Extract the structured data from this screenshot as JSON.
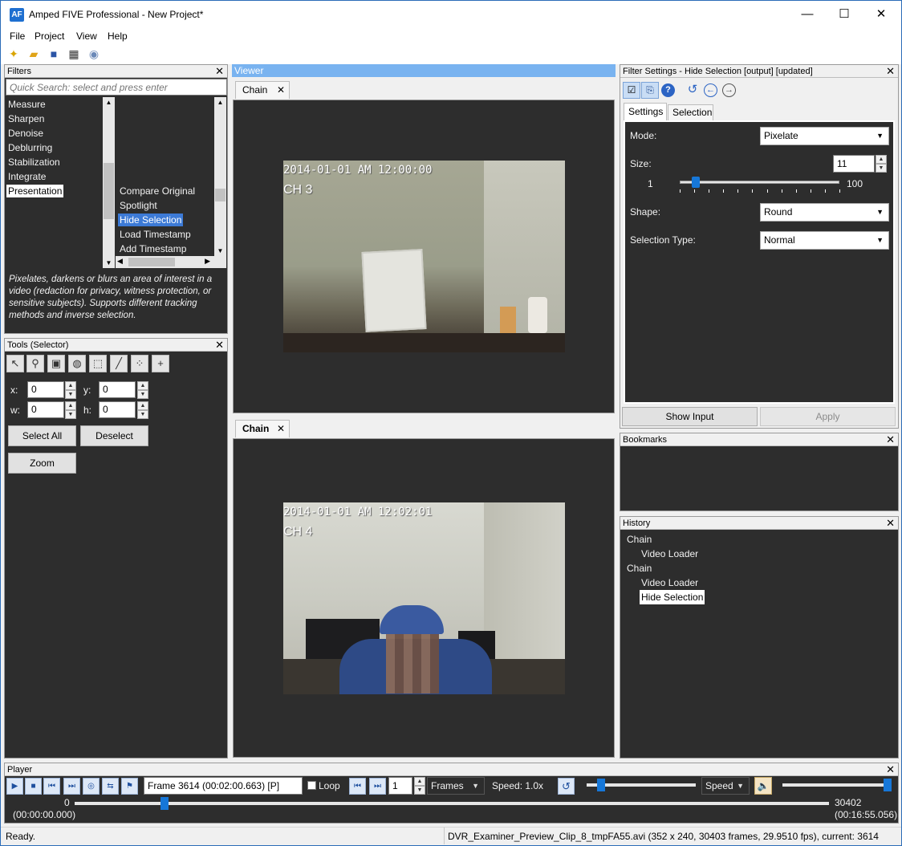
{
  "app": {
    "icon_text": "AF",
    "title": "Amped FIVE Professional - New Project*"
  },
  "window_controls": {
    "minimize": "—",
    "maximize": "☐",
    "close": "✕"
  },
  "menu": [
    "File",
    "Project",
    "View",
    "Help"
  ],
  "filters": {
    "title": "Filters",
    "search_placeholder": "Quick Search: select and press enter",
    "categories": [
      "Measure",
      "Sharpen",
      "Denoise",
      "Deblurring",
      "Stabilization",
      "Integrate",
      "Presentation"
    ],
    "selected_category": "Presentation",
    "items": [
      "Compare Original",
      "Spotlight",
      "Hide Selection",
      "Load Timestamp",
      "Add Timestamp"
    ],
    "selected_item": "Hide Selection",
    "description": "Pixelates, darkens or blurs an area of interest in a video (redaction for privacy, witness protection, or sensitive subjects). Supports different tracking methods and inverse selection."
  },
  "tools": {
    "title": "Tools (Selector)",
    "x_label": "x:",
    "x_value": "0",
    "y_label": "y:",
    "y_value": "0",
    "w_label": "w:",
    "w_value": "0",
    "h_label": "h:",
    "h_value": "0",
    "select_all": "Select All",
    "deselect": "Deselect",
    "zoom": "Zoom"
  },
  "viewer": {
    "title": "Viewer",
    "top_tab": "Chain",
    "bottom_tab": "Chain",
    "top_video": {
      "timestamp": "2014-01-01 AM 12:00:00",
      "channel": "CH 3"
    },
    "bottom_video": {
      "timestamp": "2014-01-01 AM 12:02:01",
      "channel": "CH 4"
    }
  },
  "filter_settings": {
    "title": "Filter Settings - Hide Selection [output] [updated]",
    "tabs": [
      "Settings",
      "Selection"
    ],
    "mode_label": "Mode:",
    "mode_value": "Pixelate",
    "size_label": "Size:",
    "size_value": "11",
    "size_min": "1",
    "size_max": "100",
    "size_fraction": 0.101,
    "shape_label": "Shape:",
    "shape_value": "Round",
    "selection_type_label": "Selection Type:",
    "selection_type_value": "Normal",
    "show_input": "Show Input",
    "apply": "Apply"
  },
  "bookmarks": {
    "title": "Bookmarks"
  },
  "history": {
    "title": "History",
    "items": [
      {
        "label": "Chain",
        "indent": 0
      },
      {
        "label": "Video Loader",
        "indent": 1
      },
      {
        "label": "Chain",
        "indent": 0
      },
      {
        "label": "Video Loader",
        "indent": 1
      },
      {
        "label": "Hide Selection",
        "indent": 1
      }
    ]
  },
  "player": {
    "title": "Player",
    "frame_text": "Frame 3614 (00:02:00.663) [P]",
    "loop_label": "Loop",
    "step_value": "1",
    "step_unit": "Frames",
    "speed_text": "Speed: 1.0x",
    "speed_combo": "Speed",
    "start_frame": "0",
    "start_time": "(00:00:00.000)",
    "end_frame": "30402",
    "end_time": "(00:16:55.056)",
    "position_fraction": 0.119
  },
  "status": {
    "left": "Ready.",
    "right": "DVR_Examiner_Preview_Clip_8_tmpFA55.avi (352 x 240, 30403 frames, 29.9510 fps), current: 3614"
  },
  "colors": {
    "panel_bg": "#2d2d2d",
    "selection_blue": "#3c7ad6",
    "viewer_header": "#79b3f0"
  }
}
